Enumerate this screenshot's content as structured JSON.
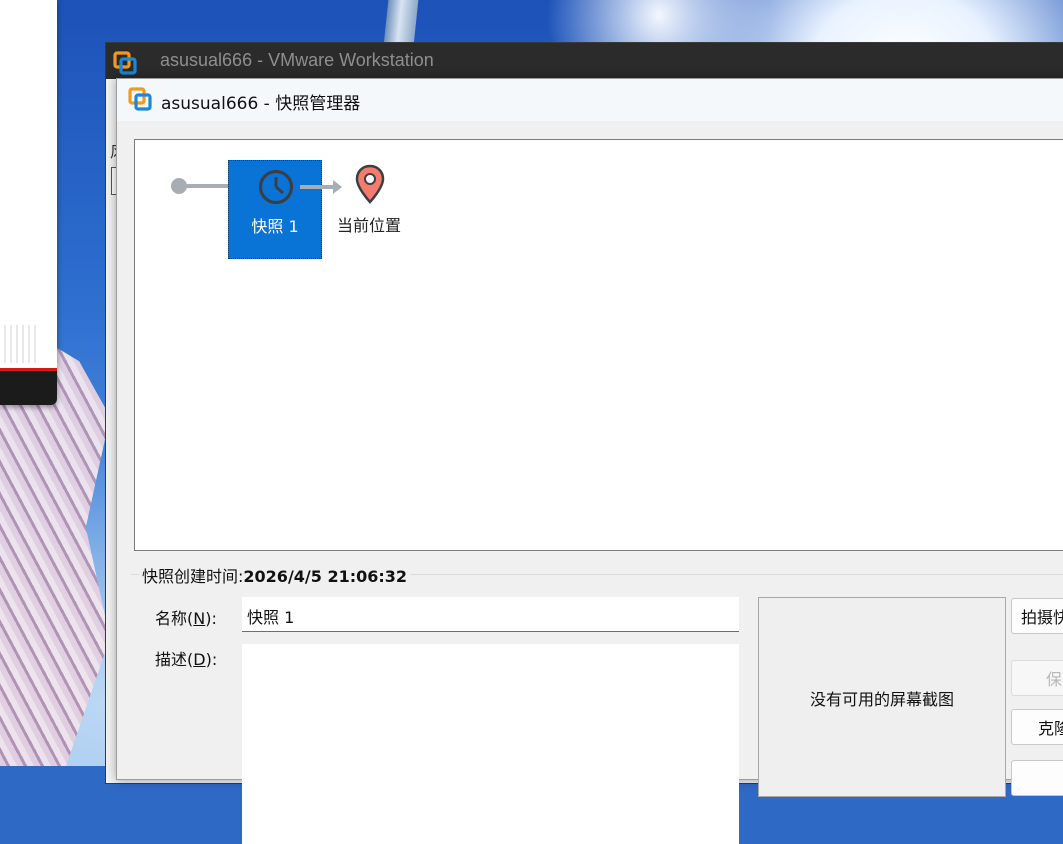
{
  "main_window": {
    "title": "asusual666 - VMware Workstation"
  },
  "behind": {
    "partial_char": "风"
  },
  "dialog": {
    "title": "asusual666 - 快照管理器"
  },
  "tree": {
    "snapshot_label": "快照 1",
    "current_label": "当前位置"
  },
  "details": {
    "created_prefix": "快照创建时间:",
    "created_value": "2026/4/5 21:06:32",
    "name_label_pre": "名称(",
    "name_label_key": "N",
    "name_label_post": "):",
    "name_value": "快照 1",
    "desc_label_pre": "描述(",
    "desc_label_key": "D",
    "desc_label_post": "):",
    "desc_value": "",
    "no_screenshot": "没有可用的屏幕截图"
  },
  "buttons": {
    "take": "拍摄快",
    "keep": "保",
    "clone": "克隆"
  },
  "colors": {
    "selection": "#0a74d6",
    "connector": "#a7adb3",
    "pin": "#f47c6e",
    "vmware_orange": "#f39a1d",
    "vmware_blue": "#1e87d6"
  }
}
